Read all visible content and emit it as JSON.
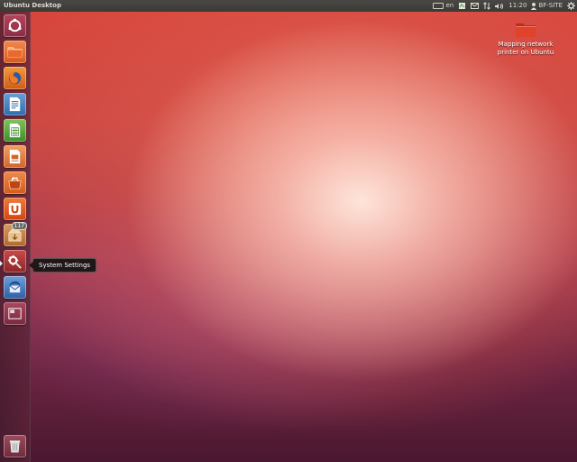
{
  "top_panel": {
    "title": "Ubuntu Desktop",
    "keyboard_layout": "en",
    "clock": "11:20",
    "user": "BF-SITE"
  },
  "launcher": {
    "items": [
      {
        "name": "dash-home",
        "icon": "ubuntu-logo-icon"
      },
      {
        "name": "home-folder",
        "icon": "folder-icon"
      },
      {
        "name": "firefox",
        "icon": "firefox-icon"
      },
      {
        "name": "libreoffice-writer",
        "icon": "writer-icon"
      },
      {
        "name": "libreoffice-calc",
        "icon": "calc-icon"
      },
      {
        "name": "libreoffice-impress",
        "icon": "impress-icon"
      },
      {
        "name": "ubuntu-software-center",
        "icon": "software-center-icon"
      },
      {
        "name": "ubuntu-one",
        "icon": "ubuntu-one-icon"
      },
      {
        "name": "update-manager",
        "icon": "update-manager-icon",
        "badge": "117"
      },
      {
        "name": "system-settings",
        "icon": "system-settings-icon"
      },
      {
        "name": "thunderbird",
        "icon": "thunderbird-icon"
      },
      {
        "name": "workspace-switcher",
        "icon": "workspace-icon"
      },
      {
        "name": "trash",
        "icon": "trash-icon"
      }
    ]
  },
  "tooltip": {
    "text": "System Settings"
  },
  "desktop_icons": [
    {
      "label": "Mapping network printer on Ubuntu",
      "icon": "folder-icon",
      "color": "#e0432b"
    }
  ],
  "colors": {
    "panel": "#3c3b37",
    "accent_orange": "#dd4814",
    "folder_red": "#e0432b"
  }
}
